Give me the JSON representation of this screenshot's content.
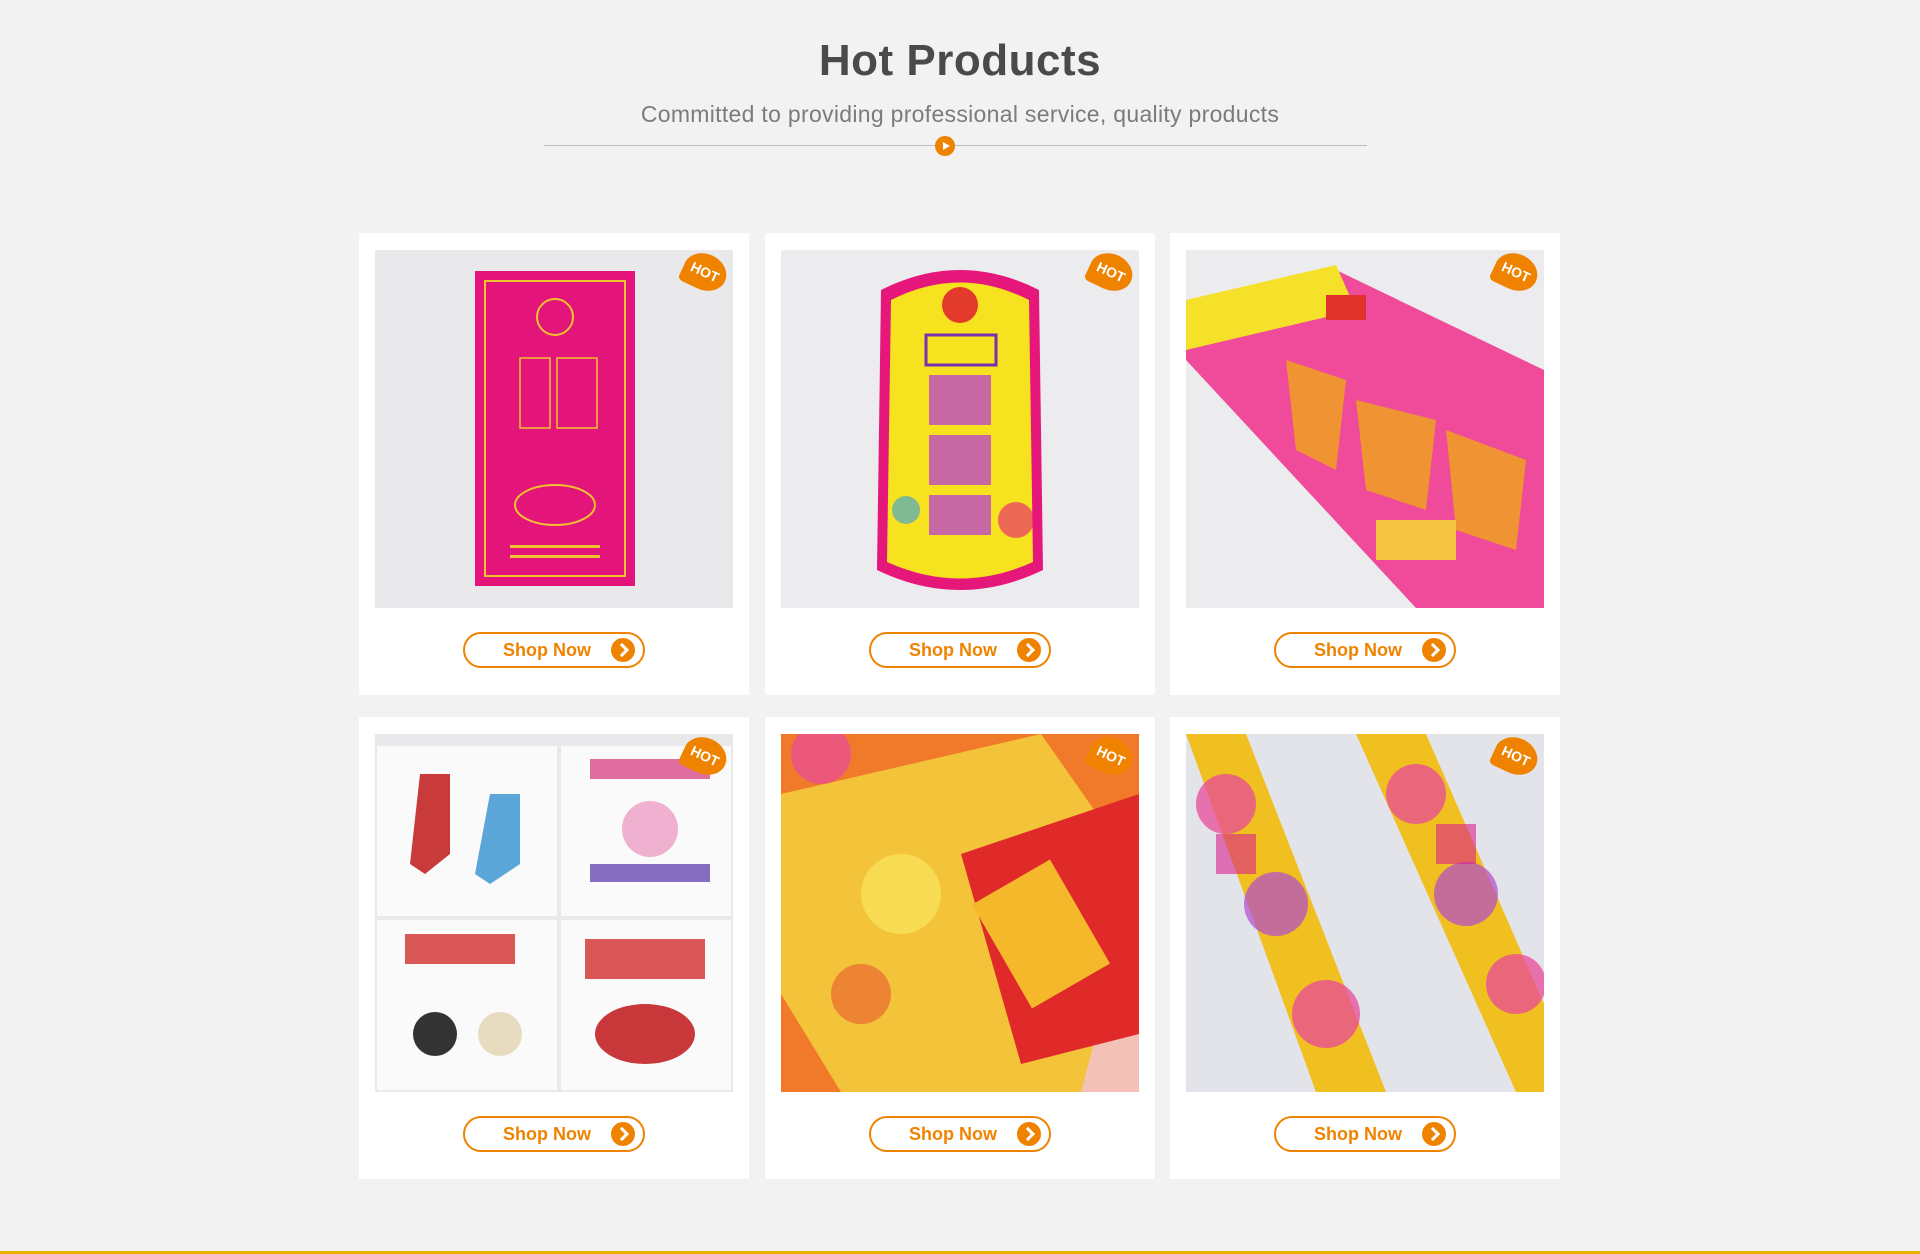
{
  "section": {
    "title": "Hot Products",
    "subtitle": "Committed to providing professional service, quality products"
  },
  "products": [
    {
      "badge": "HOT",
      "button_label": "Shop Now",
      "image": "pink-incense-label"
    },
    {
      "badge": "HOT",
      "button_label": "Shop Now",
      "image": "yellow-incense-label"
    },
    {
      "badge": "HOT",
      "button_label": "Shop Now",
      "image": "pink-incense-box"
    },
    {
      "badge": "HOT",
      "button_label": "Shop Now",
      "image": "christmas-stickers"
    },
    {
      "badge": "HOT",
      "button_label": "Shop Now",
      "image": "red-gold-embossed-label"
    },
    {
      "badge": "HOT",
      "button_label": "Shop Now",
      "image": "floral-couplet-labels"
    }
  ],
  "colors": {
    "accent": "#ef8300",
    "background": "#f2f2f2",
    "title": "#4a4a4a"
  }
}
